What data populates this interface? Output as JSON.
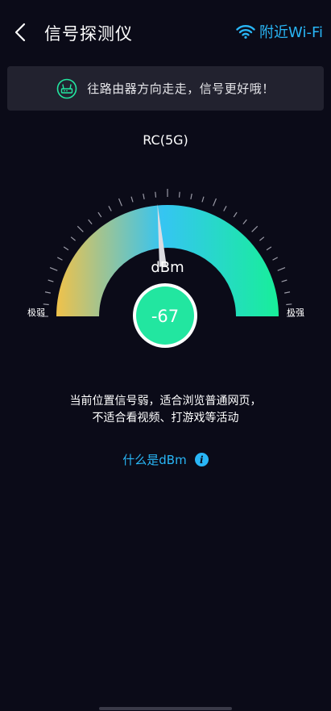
{
  "header": {
    "title": "信号探测仪",
    "nearby_wifi_label": "附近Wi-Fi"
  },
  "tip": {
    "text": "往路由器方向走走，信号更好哦！"
  },
  "network": {
    "name": "RC(5G)"
  },
  "gauge": {
    "unit": "dBm",
    "value": "-67",
    "label_min": "极弱",
    "label_max": "极强",
    "colors": {
      "weak": "#f0c24a",
      "mid": "#35c5f2",
      "strong": "#18ee9a",
      "value_circle": "#22e6a0"
    }
  },
  "status": {
    "line1": "当前位置信号弱，适合浏览普通网页，",
    "line2": "不适合看视频、打游戏等活动"
  },
  "help": {
    "link_text": "什么是dBm"
  },
  "accent_color": "#29b6f6"
}
